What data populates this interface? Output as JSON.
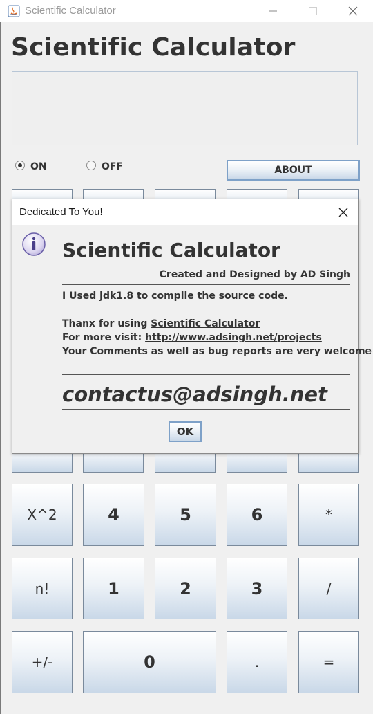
{
  "window": {
    "title": "Scientific Calculator",
    "minimize_glyph": "—",
    "close_glyph": "✕"
  },
  "heading": "Scientific Calculator",
  "display": {
    "value": ""
  },
  "power": {
    "on_label": "ON",
    "off_label": "OFF",
    "selected": "ON"
  },
  "about_label": "ABOUT",
  "keypad": {
    "row_hidden_1": [
      "",
      "",
      "",
      "",
      ""
    ],
    "row_hidden_2": [
      "",
      "",
      "",
      "",
      ""
    ],
    "row_456": [
      "X^2",
      "4",
      "5",
      "6",
      "*"
    ],
    "row_123": [
      "n!",
      "1",
      "2",
      "3",
      "/"
    ],
    "row_0": [
      "+/-",
      "0",
      ".",
      "="
    ]
  },
  "dialog": {
    "title": "Dedicated To You!",
    "icon": "info-icon",
    "heading": "Scientific Calculator",
    "credit": "Created and Designed by AD Singh",
    "jdk_line": "I Used jdk1.8 to compile the source code.",
    "thanks_prefix": "Thanx for using ",
    "thanks_link": "Scientific Calculator",
    "visit_prefix": "For more visit: ",
    "visit_link": "http://www.adsingh.net/projects",
    "comments": "Your Comments as well as bug reports are very welcome at",
    "email": "contactus@adsingh.net",
    "ok_label": "OK"
  },
  "colors": {
    "button_border": "#7a8a9c",
    "button_gradient_bottom": "#c9d8e8",
    "focus_border": "#7ea1c8",
    "text": "#333333"
  }
}
